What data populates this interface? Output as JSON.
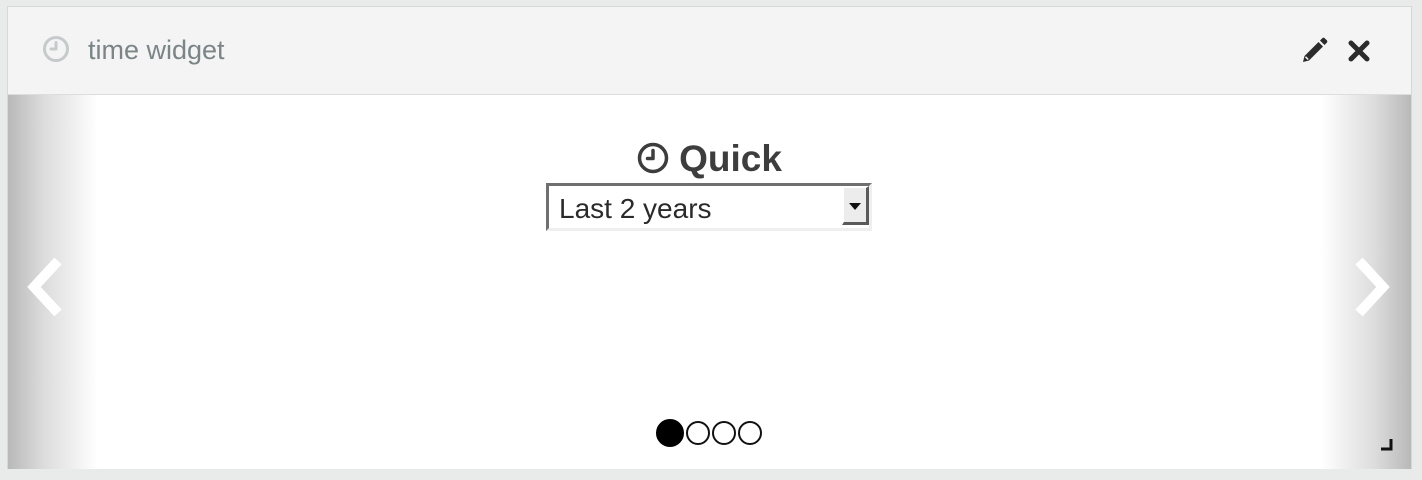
{
  "widget": {
    "title": "time widget",
    "header_icons": {
      "clock": "clock-icon",
      "edit": "pencil-icon",
      "close": "close-icon"
    }
  },
  "slide": {
    "heading": "Quick",
    "heading_icon": "clock-icon",
    "select": {
      "value": "Last 2 years"
    }
  },
  "carousel": {
    "prev_icon": "chevron-left-icon",
    "next_icon": "chevron-right-icon",
    "page_count": 4,
    "active_index": 0
  },
  "colors": {
    "header_bg": "#f4f4f4",
    "title_text": "#7b8588",
    "heading_text": "#3d3d3d",
    "icon_dark": "#2b2b2b"
  }
}
